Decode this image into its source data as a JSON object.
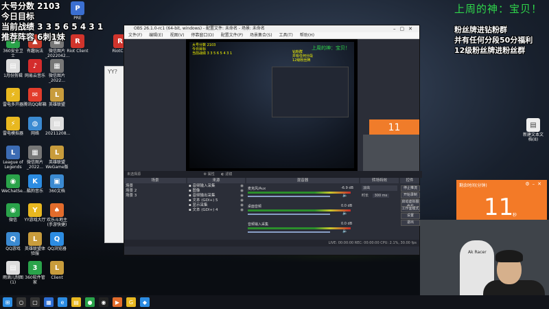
{
  "overlay": {
    "left_lines": [
      "大号分数 2103",
      "今日目标",
      "当前战绩 3 3 5 6 5 4 3 1",
      "推荐阵容 6刺1妹"
    ],
    "right_top": "上周的神：宝贝！",
    "right_lines": [
      "粉丝牌进钻粉群",
      "并有任何分段50分福利",
      "12级粉丝牌进粉丝群"
    ]
  },
  "desktop_icons": [
    {
      "label": "360安全卫士",
      "glyph": "3",
      "color": "#2aa34a"
    },
    {
      "label": "PRE",
      "glyph": "P",
      "color": "#3b6fd1"
    },
    {
      "label": "有趣玩法",
      "glyph": "▲",
      "color": "#c83c2c"
    },
    {
      "label": "微信图片_2022042...",
      "glyph": "▦",
      "color": "#777"
    },
    {
      "label": "Riot Client",
      "glyph": "R",
      "color": "#d0342c"
    },
    {
      "label": "RiotClie",
      "glyph": "R",
      "color": "#d0342c"
    },
    {
      "label": "1月份剪辑",
      "glyph": "▤",
      "color": "#ddd"
    },
    {
      "label": "网易云音乐",
      "glyph": "♪",
      "color": "#d42c2c"
    },
    {
      "label": "微信图片_2022...",
      "glyph": "▦",
      "color": "#777"
    },
    {
      "label": "雷电多开器",
      "glyph": "⚡",
      "color": "#e8b820"
    },
    {
      "label": "腾讯QQ邮箱",
      "glyph": "✉",
      "color": "#e23c2c"
    },
    {
      "label": "英雄联盟",
      "glyph": "L",
      "color": "#c89c3c"
    },
    {
      "label": "雷电模拟器",
      "glyph": "⚡",
      "color": "#e8b820"
    },
    {
      "label": "网络",
      "glyph": "◍",
      "color": "#3b8ad1"
    },
    {
      "label": "20211208...",
      "glyph": "▤",
      "color": "#ddd"
    },
    {
      "label": "League of Legends",
      "glyph": "L",
      "color": "#3c6cb4"
    },
    {
      "label": "微信图片_2022...",
      "glyph": "▦",
      "color": "#777"
    },
    {
      "label": "英雄联盟WeGame版",
      "glyph": "L",
      "color": "#c89c3c"
    },
    {
      "label": "WeChatSe...",
      "glyph": "◉",
      "color": "#2aa34a"
    },
    {
      "label": "酷狗音乐",
      "glyph": "K",
      "color": "#2c8ce2"
    },
    {
      "label": "360文档",
      "glyph": "▣",
      "color": "#3b8ad1"
    },
    {
      "label": "微信",
      "glyph": "◉",
      "color": "#2aa34a"
    },
    {
      "label": "YY游戏大厅",
      "glyph": "Y",
      "color": "#e8b820"
    },
    {
      "label": "欢乐斗地主(手游快捷)",
      "glyph": "♠",
      "color": "#e26c2c"
    },
    {
      "label": "QQ游戏",
      "glyph": "Q",
      "color": "#3b8ad1"
    },
    {
      "label": "英雄联盟体验服",
      "glyph": "L",
      "color": "#c89c3c"
    },
    {
      "label": "QQ浏览器",
      "glyph": "Q",
      "color": "#2c8ce2"
    },
    {
      "label": "雨滴儿制图(1)",
      "glyph": "▤",
      "color": "#ddd"
    },
    {
      "label": "360软件管家",
      "glyph": "3",
      "color": "#2aa34a"
    },
    {
      "label": "Client",
      "glyph": "L",
      "color": "#c89c3c"
    }
  ],
  "right_desktop_icon": {
    "label": "新建文本文档(8)",
    "glyph": "▤"
  },
  "yy_window": {
    "title": "YY?"
  },
  "obs": {
    "title": "OBS 26.1.0-rc1 (64-bit, windows) - 配置文件: 未命名 - 场景: 未命名",
    "menu": [
      "文件(F)",
      "编辑(E)",
      "视图(V)",
      "停靠窗口(D)",
      "配置文件(P)",
      "场景集合(S)",
      "工具(T)",
      "帮助(H)"
    ],
    "preview_title": "上周的神：宝贝！",
    "preview_small": [
      "大号分数 2103",
      "今日目标",
      "当前战绩 3 3 5 6 5 4 3 1"
    ],
    "preview_right": [
      "钻粉群",
      "并有任何分段",
      "12级粉丝牌"
    ],
    "no_source": "未选择源",
    "properties": "属性",
    "filters": "滤镜",
    "panel_headers": [
      "场景",
      "来源",
      "混音器",
      "转场特效",
      "控件"
    ],
    "scenes": [
      "场景",
      "场景 2",
      "场景 3"
    ],
    "sources": [
      "音频输入采集",
      "图像",
      "音频输出采集",
      "文本 (GDI+) 5",
      "显示采集",
      "文本 (GDI+) 4"
    ],
    "mixer": [
      {
        "name": "麦克风/Aux",
        "db": "-6.9 dB"
      },
      {
        "name": "桌面音频",
        "db": "0.0 dB"
      },
      {
        "name": "音频输入采集",
        "db": "0.0 dB"
      }
    ],
    "transition": {
      "type": "淡出",
      "duration_label": "时长",
      "duration": "300 ms"
    },
    "controls": [
      "停止推流",
      "开始录制",
      "启动虚拟摄像机",
      "工作室模式",
      "设置",
      "退出"
    ],
    "status": "LIVE: 00:00:00   REC: 00:00:00   CPU: 2.1%, 30.00 fps"
  },
  "timer": {
    "header": "剩余时间(分钟)",
    "value": "11",
    "unit": "秒"
  },
  "webcam": {
    "chair_brand": "Ak Racer"
  },
  "taskbar": {
    "apps": [
      {
        "glyph": "⊞",
        "color": "#2c8ce2"
      },
      {
        "glyph": "○",
        "color": "#333"
      },
      {
        "glyph": "▢",
        "color": "#333"
      },
      {
        "glyph": "▦",
        "color": "#2c6cd1"
      },
      {
        "glyph": "e",
        "color": "#2c8ce2"
      },
      {
        "glyph": "▤",
        "color": "#e8b820"
      },
      {
        "glyph": "●",
        "color": "#2aa34a"
      },
      {
        "glyph": "◉",
        "color": "#222"
      },
      {
        "glyph": "▶",
        "color": "#e26c2c"
      },
      {
        "glyph": "G",
        "color": "#e8b820"
      },
      {
        "glyph": "◆",
        "color": "#2c8ce2"
      }
    ],
    "time": "",
    "date": ""
  }
}
